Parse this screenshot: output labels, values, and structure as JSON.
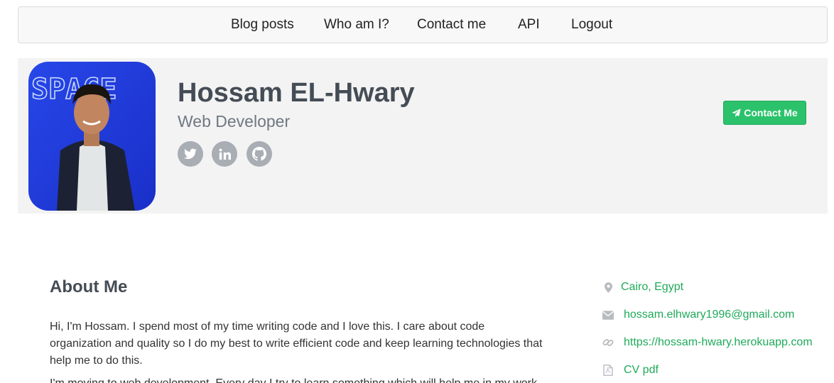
{
  "nav": {
    "items": [
      {
        "label": "Blog posts"
      },
      {
        "label": "Who am I?"
      },
      {
        "label": "Contact me"
      },
      {
        "label": "API"
      },
      {
        "label": "Logout"
      }
    ]
  },
  "profile": {
    "name": "Hossam EL-Hwary",
    "title": "Web Developer",
    "contact_button": "Contact Me",
    "social_icons": [
      "twitter-icon",
      "linkedin-icon",
      "github-icon"
    ],
    "avatar_wall_text": "SPACE"
  },
  "about": {
    "heading": "About Me",
    "paragraphs": [
      "Hi, I'm Hossam. I spend most of my time writing code and I love this. I care about code organization and quality so I do my best to write efficient code and keep learning technologies that help me to do this.",
      "I'm moving to web development. Every day I try to learn something which will help me in my work."
    ]
  },
  "info": {
    "location": "Cairo, Egypt",
    "email": "hossam.elhwary1996@gmail.com",
    "website": "https://hossam-hwary.herokuapp.com",
    "cv": "CV pdf"
  },
  "colors": {
    "accent": "#2bc26b",
    "link": "#1faa5a",
    "band": "#f3f3f3",
    "social": "#a9adb4"
  }
}
